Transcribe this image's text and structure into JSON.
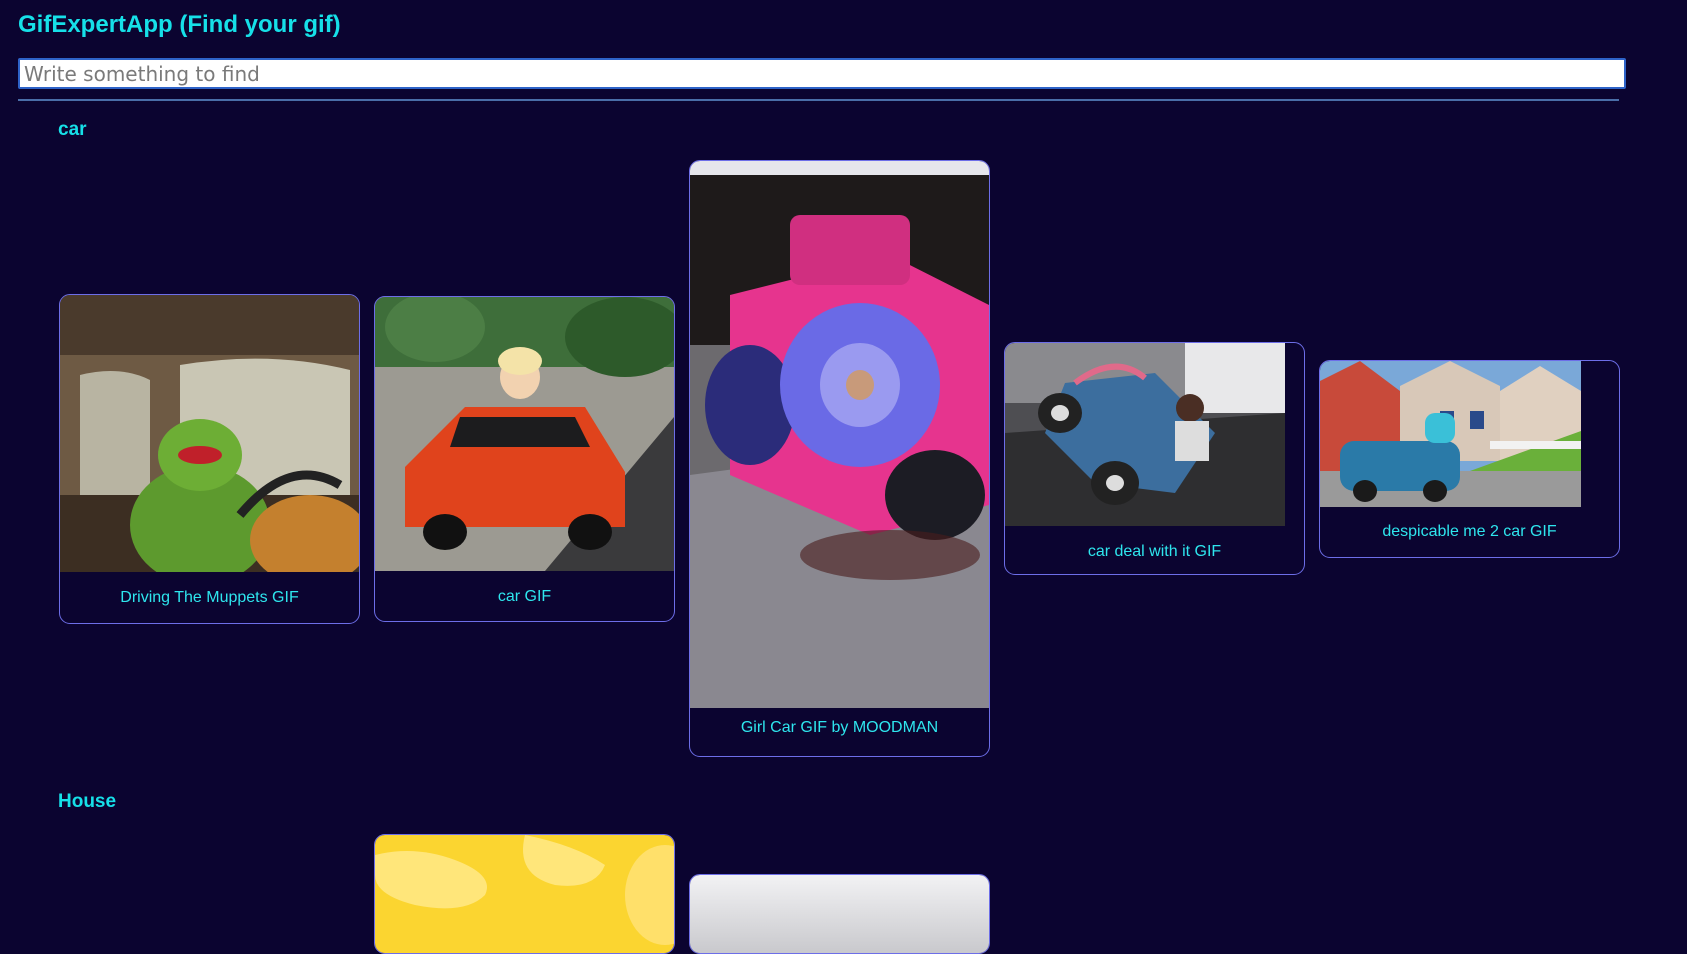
{
  "app": {
    "title": "GifExpertApp (Find your gif)"
  },
  "search": {
    "placeholder": "Write something to find",
    "value": ""
  },
  "categories": [
    {
      "title": "car",
      "gifs": [
        {
          "caption": "Driving The Muppets GIF"
        },
        {
          "caption": "car GIF"
        },
        {
          "caption": "Girl Car GIF by MOODMAN"
        },
        {
          "caption": "car deal with it GIF"
        },
        {
          "caption": "despicable me 2 car GIF"
        }
      ]
    },
    {
      "title": "House",
      "gifs": [
        {
          "caption": ""
        },
        {
          "caption": ""
        }
      ]
    }
  ],
  "colors": {
    "background": "#0b0430",
    "accent": "#16e0e8",
    "card_border": "#6d6ee8",
    "search_border": "#2e63c8"
  }
}
